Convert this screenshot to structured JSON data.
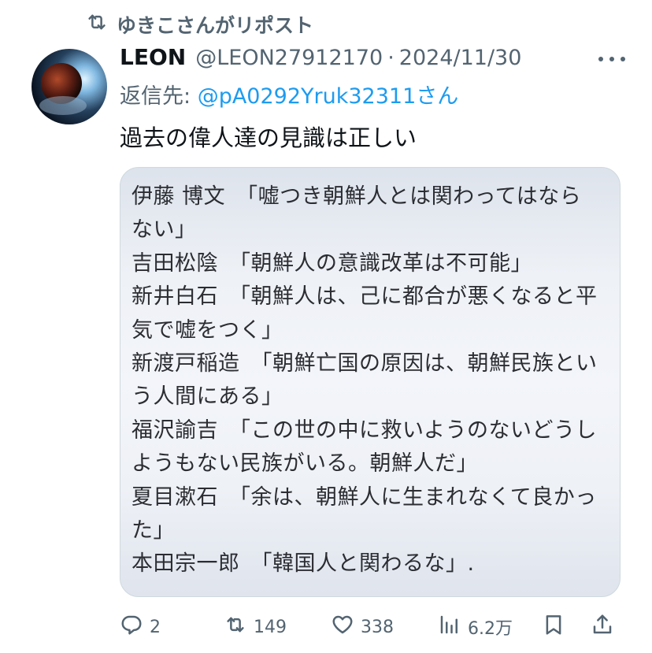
{
  "repost": {
    "text": "ゆきこさんがリポスト"
  },
  "author": {
    "name": "LEON",
    "handle": "@LEON27912170",
    "date": "2024/11/30"
  },
  "reply": {
    "prefix": "返信先: ",
    "handle": "@pA0292Yruk32311",
    "suffix": "さん"
  },
  "post": {
    "text": "過去の偉人達の見識は正しい"
  },
  "image_text": {
    "lines": [
      "伊藤 博文　「嘘つき朝鮮人とは関わってはなら",
      "ない」",
      "吉田松陰　「朝鮮人の意識改革は不可能」",
      "新井白石　「朝鮮人は、己に都合が悪くなると平",
      "気で嘘をつく」",
      "新渡戸稲造　「朝鮮亡国の原因は、朝鮮民族とい",
      "う人間にある」",
      "福沢諭吉　「この世の中に救いようのないどうし",
      "ようもない民族がいる。朝鮮人だ」",
      "夏目漱石　「余は、朝鮮人に生まれなくて良かっ",
      "た」",
      "本田宗一郎　「韓国人と関わるな」."
    ]
  },
  "actions": {
    "replies": "2",
    "reposts": "149",
    "likes": "338",
    "views": "6.2万"
  },
  "colors": {
    "text": "#0f1419",
    "secondary": "#536471",
    "link": "#1d9bf0"
  }
}
